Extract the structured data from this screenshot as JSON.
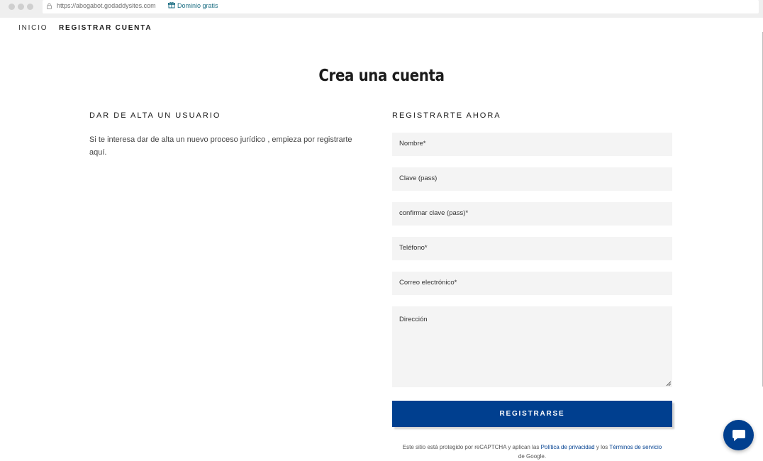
{
  "browser": {
    "url": "https://abogabot.godaddysites.com",
    "badge_label": "Dominio gratis"
  },
  "nav": {
    "items": [
      {
        "label": "INICIO",
        "active": false
      },
      {
        "label": "REGISTRAR CUENTA",
        "active": true
      }
    ]
  },
  "page": {
    "title": "Crea una cuenta"
  },
  "left": {
    "heading": "DAR DE ALTA UN USUARIO",
    "text": "Si te interesa dar de alta un nuevo proceso jurídico , empieza por registrarte aquí."
  },
  "form": {
    "heading": "REGISTRARTE AHORA",
    "fields": [
      {
        "label": "Nombre*",
        "value": ""
      },
      {
        "label": "Clave (pass)",
        "value": ""
      },
      {
        "label": "confirmar clave (pass)*",
        "value": ""
      },
      {
        "label": "Teléfono*",
        "value": ""
      },
      {
        "label": "Correo electrónico*",
        "value": ""
      },
      {
        "label": "Dirección",
        "value": ""
      }
    ],
    "submit_label": "REGISTRARSE",
    "recaptcha": {
      "prefix": "Este sitio está protegido por reCAPTCHA y aplican las",
      "privacy_link": "Política de privacidad",
      "middle": "y los",
      "terms_link": "Términos de servicio",
      "suffix": "de Google."
    }
  },
  "colors": {
    "accent": "#003f8f",
    "field_background": "#f4f4f4",
    "link": "#1c6e83"
  },
  "icons": {
    "lock": "lock-icon",
    "gift": "gift-icon",
    "chat": "chat-bubble-icon"
  }
}
